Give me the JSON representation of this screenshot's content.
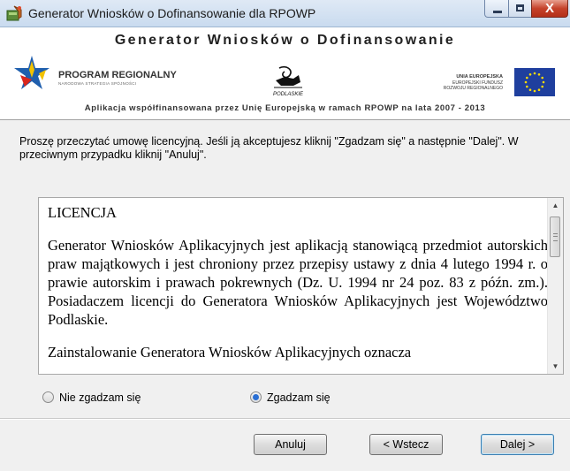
{
  "window": {
    "title": "Generator Wniosków o Dofinansowanie dla RPOWP",
    "close_glyph": "X"
  },
  "banner": {
    "title": "Generator Wniosków o Dofinansowanie",
    "program_name": "PROGRAM REGIONALNY",
    "program_subtitle": "NARODOWA STRATEGIA SPÓJNOŚCI",
    "podlasie_label": "PODLASKIE",
    "eu_line1": "UNIA EUROPEJSKA",
    "eu_line2": "EUROPEJSKI FUNDUSZ",
    "eu_line3": "ROZWOJU REGIONALNEGO",
    "cofinancing": "Aplikacja współfinansowana przez Unię Europejską w ramach RPOWP na lata 2007 - 2013",
    "eu_flag_color": "#1f3f9e"
  },
  "instruction": "Proszę przeczytać umowę licencyjną. Jeśli ją akceptujesz kliknij \"Zgadzam się\" a następnie \"Dalej\". W przeciwnym przypadku kliknij \"Anuluj\".",
  "license": {
    "heading": "LICENCJA",
    "paragraph1": "Generator Wniosków Aplikacyjnych jest aplikacją stanowiącą przedmiot autorskich praw majątkowych i jest chroniony przez przepisy ustawy z dnia 4 lutego 1994 r. o prawie autorskim i prawach pokrewnych (Dz. U. 1994 nr 24 poz. 83 z późn. zm.). Posiadaczem licencji do Generatora Wniosków Aplikacyjnych jest Województwo Podlaskie.",
    "paragraph2": "Zainstalowanie Generatora Wniosków Aplikacyjnych oznacza"
  },
  "options": {
    "disagree_label": "Nie zgadzam się",
    "agree_label": "Zgadzam się",
    "selected": "agree"
  },
  "buttons": {
    "cancel_label": "Anuluj",
    "back_label": "< Wstecz",
    "next_label": "Dalej >"
  }
}
